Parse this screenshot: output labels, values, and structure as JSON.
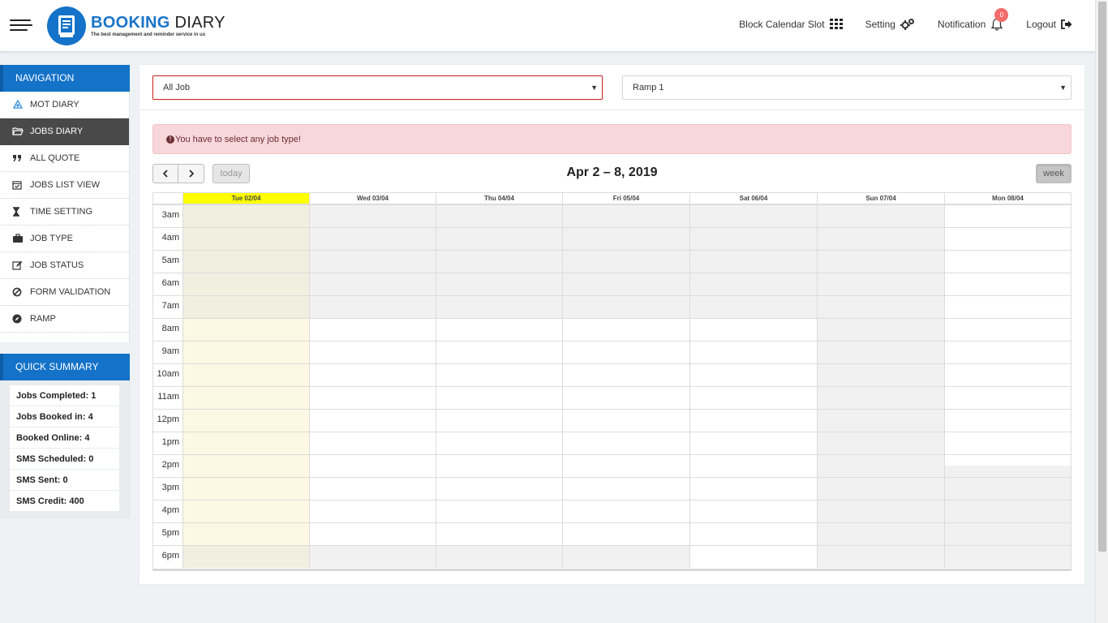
{
  "header": {
    "logo": {
      "brand_bold": "BOOKING",
      "brand_light": "DIARY",
      "tagline": "The best management and reminder service in us"
    },
    "links": {
      "block_calendar": "Block Calendar Slot",
      "setting": "Setting",
      "notification": "Notification",
      "notification_count": "0",
      "logout": "Logout"
    }
  },
  "sidebar": {
    "nav_title": "NAVIGATION",
    "items": [
      {
        "label": "MOT DIARY",
        "icon": "mot-icon"
      },
      {
        "label": "JOBS DIARY",
        "icon": "folder-open-icon",
        "active": true
      },
      {
        "label": "ALL QUOTE",
        "icon": "quote-icon"
      },
      {
        "label": "JOBS LIST VIEW",
        "icon": "calendar-check-icon"
      },
      {
        "label": "TIME SETTING",
        "icon": "hourglass-icon"
      },
      {
        "label": "JOB TYPE",
        "icon": "briefcase-icon"
      },
      {
        "label": "JOB STATUS",
        "icon": "edit-icon"
      },
      {
        "label": "FORM VALIDATION",
        "icon": "ban-icon"
      },
      {
        "label": "RAMP",
        "icon": "compass-icon"
      }
    ],
    "summary_title": "QUICK SUMMARY",
    "summary": [
      "Jobs Completed: 1",
      "Jobs Booked in: 4",
      "Booked Online: 4",
      "SMS Scheduled: 0",
      "SMS Sent: 0",
      "SMS Credit: 400"
    ]
  },
  "filters": {
    "job_select": "All Job",
    "ramp_select": "Ramp 1"
  },
  "alert": {
    "message": "You have to select any job type!"
  },
  "calendar": {
    "title": "Apr 2 – 8, 2019",
    "today_label": "today",
    "view_label": "week",
    "days": [
      "Tue 02/04",
      "Wed 03/04",
      "Thu 04/04",
      "Fri 05/04",
      "Sat 06/04",
      "Sun 07/04",
      "Mon 08/04"
    ],
    "times": [
      "3am",
      "4am",
      "5am",
      "6am",
      "7am",
      "8am",
      "9am",
      "10am",
      "11am",
      "12pm",
      "1pm",
      "2pm",
      "3pm",
      "4pm",
      "5pm",
      "6pm"
    ]
  },
  "colors": {
    "brand_blue": "#1473c8",
    "active_nav": "#494949",
    "alert_bg": "#f8d7da",
    "today_header": "#ffff00",
    "today_column": "#fcf8e3",
    "blocked_cell": "#f1f1f1"
  }
}
